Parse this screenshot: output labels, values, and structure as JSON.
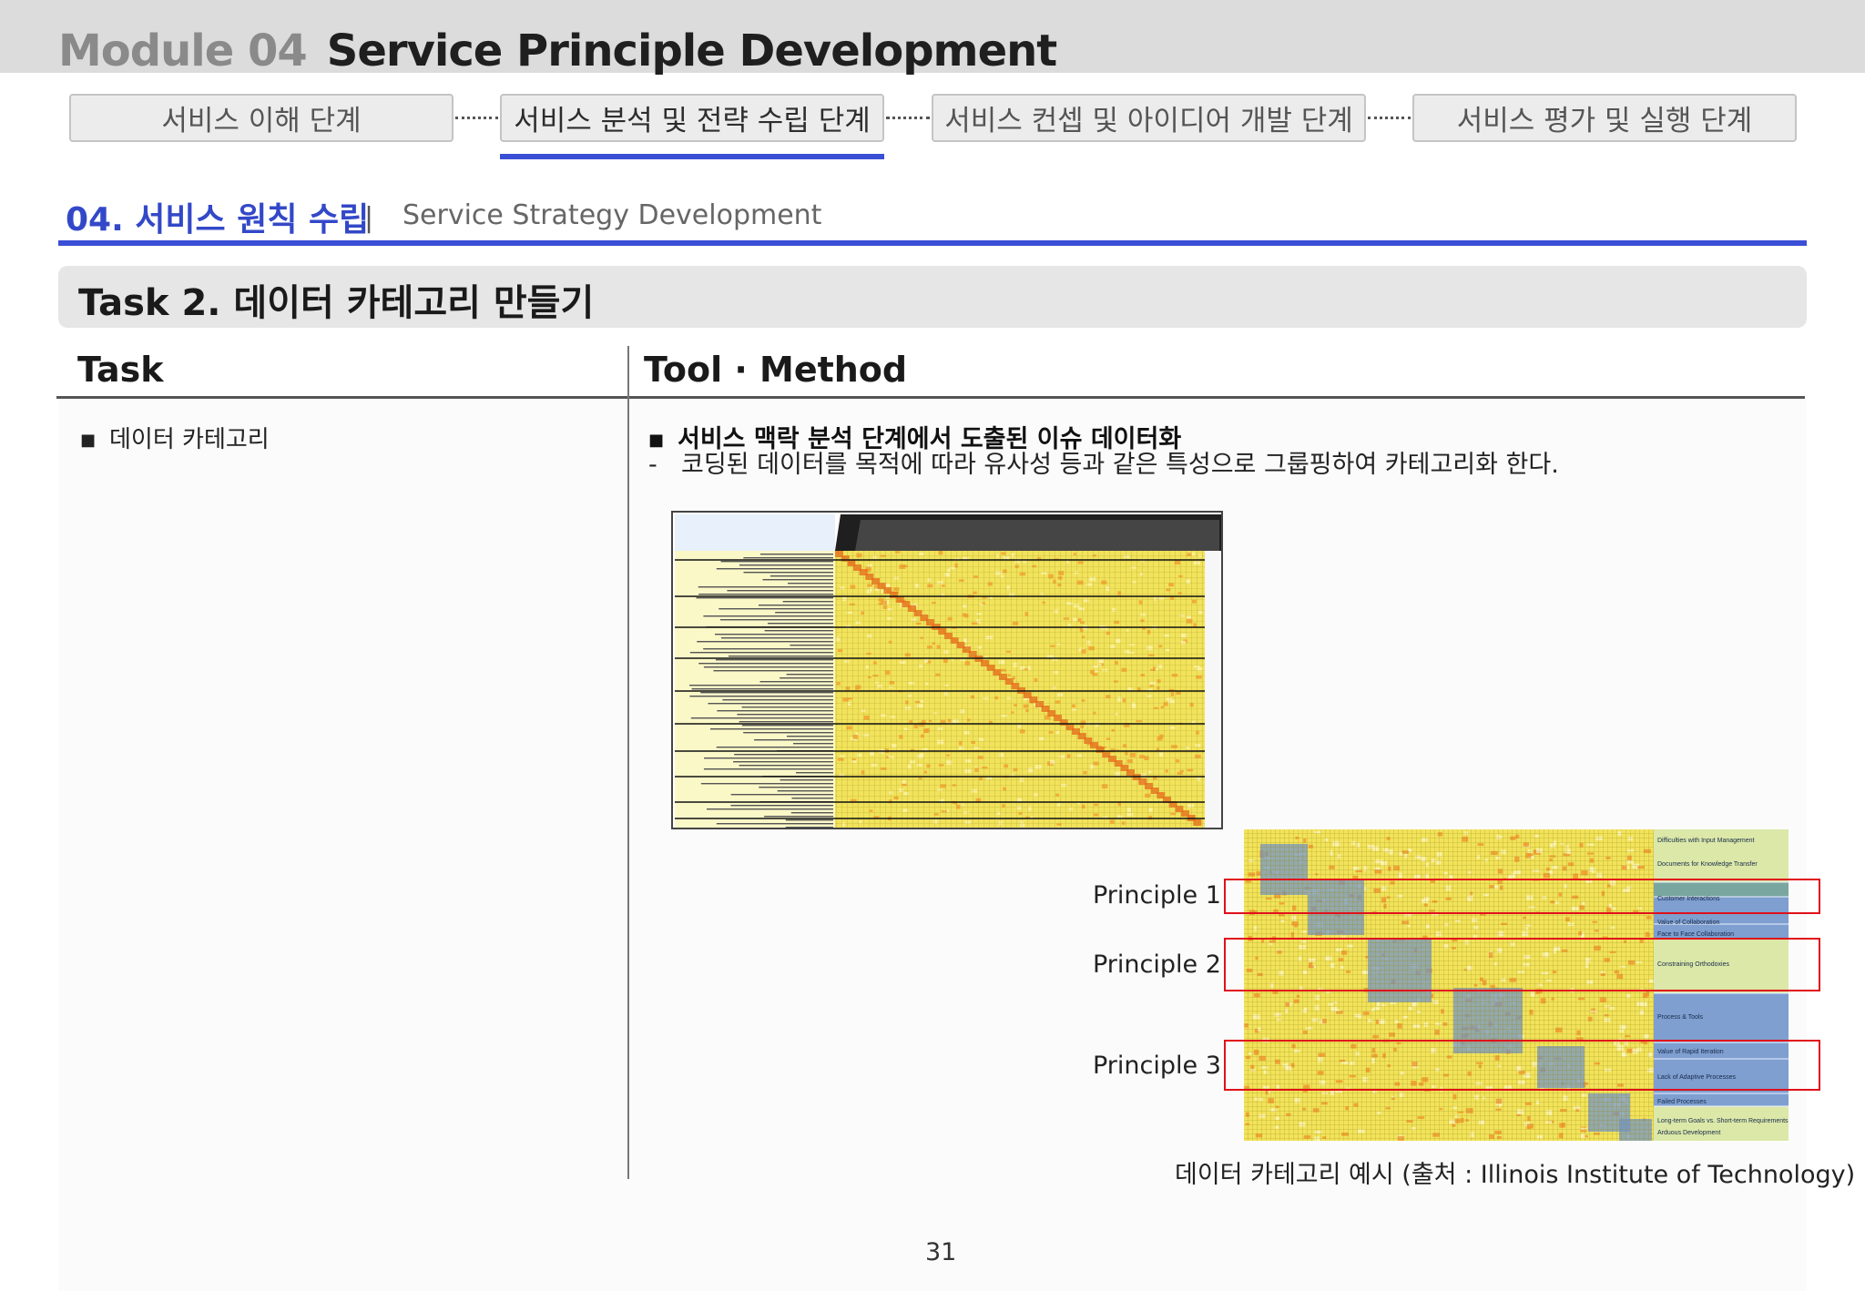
{
  "header": {
    "module_num": "Module 04",
    "module_name": "Service Principle Development"
  },
  "steps": [
    {
      "label": "서비스 이해 단계",
      "active": false
    },
    {
      "label": "서비스 분석 및 전략 수립 단계",
      "active": true
    },
    {
      "label": "서비스 컨셉 및 아이디어 개발 단계",
      "active": false
    },
    {
      "label": "서비스 평가 및 실행 단계",
      "active": false
    }
  ],
  "section": {
    "title": "04. 서비스 원칙 수립",
    "separator": "|",
    "subtitle": "Service Strategy Development"
  },
  "task_header": "Task 2. 데이터 카테고리 만들기",
  "columns": {
    "task": "Task",
    "tool": "Tool · Method"
  },
  "task_items": [
    "데이터 카테고리"
  ],
  "tool_items": {
    "bullet": "서비스 맥락 분석 단계에서 도출된 이슈 데이터화",
    "dash": "코딩된 데이터를 목적에 따라 유사성 등과 같은 특성으로 그룹핑하여 카테고리화 한다."
  },
  "principles": [
    "Principle 1",
    "Principle 2",
    "Principle 3"
  ],
  "category_labels": [
    "Difficulties with Input Management",
    "Documents for Knowledge Transfer",
    "Customer Interactions",
    "Value of Collaboration",
    "Face to Face Collaboration",
    "Constraining Orthodoxies",
    "Process & Tools",
    "Value of Rapid Iteration",
    "Lack of Adaptive Processes",
    "Failed Processes",
    "Long-term Goals vs. Short-term Requirements",
    "Arduous Development"
  ],
  "caption": "데이터 카테고리 예시 (출처 : Illinois Institute of Technology)",
  "page_number": "31",
  "colors": {
    "accent_blue": "#3a4fd6",
    "highlight_red": "#e0101a",
    "matrix_yellow": "#f3e43a",
    "cluster_blue": "#7e9fd0",
    "category_green": "#dbe8a8"
  }
}
